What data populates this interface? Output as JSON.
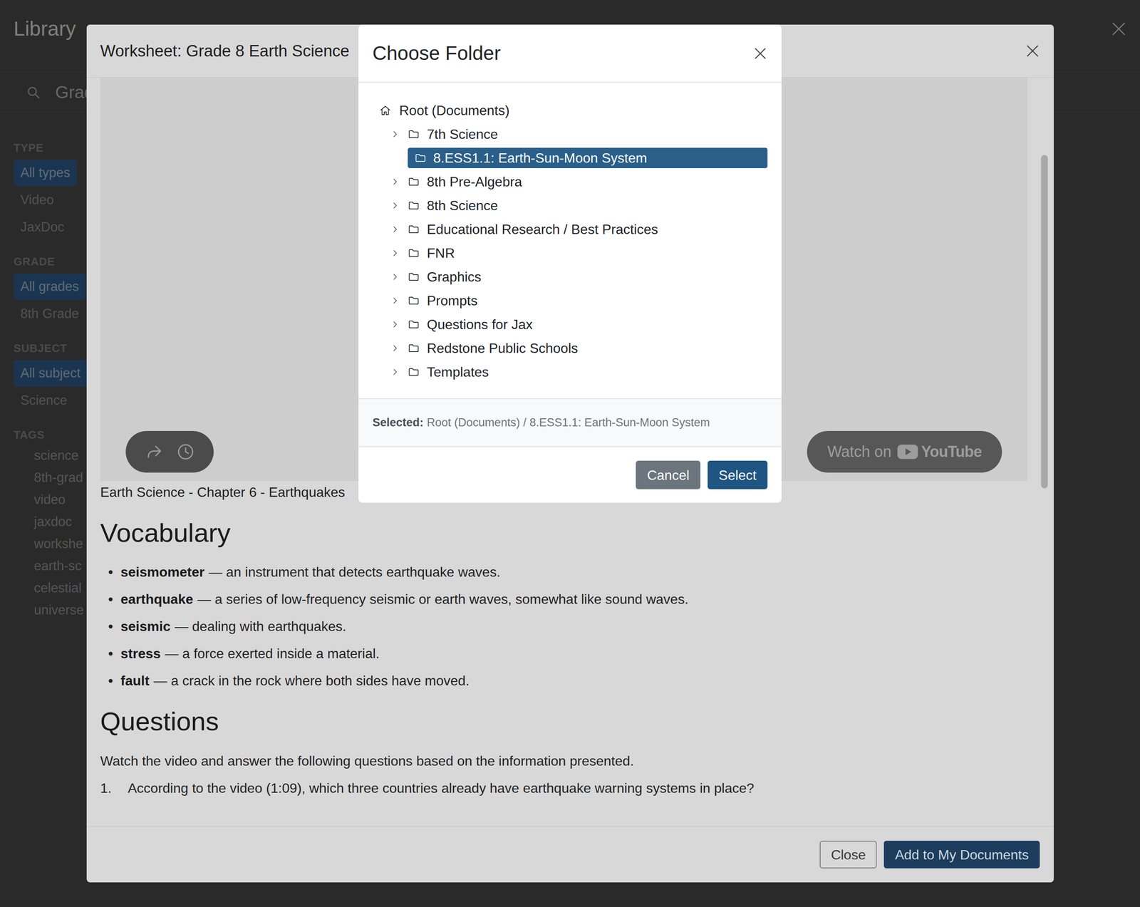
{
  "library": {
    "title": "Library",
    "search": {
      "value": "Grad"
    },
    "filters": [
      {
        "heading": "TYPE",
        "options": [
          {
            "label": "All types",
            "selected": true
          },
          {
            "label": "Video",
            "selected": false
          },
          {
            "label": "JaxDoc",
            "selected": false
          }
        ]
      },
      {
        "heading": "GRADE",
        "options": [
          {
            "label": "All grades",
            "selected": true
          },
          {
            "label": "8th Grade",
            "selected": false
          }
        ]
      },
      {
        "heading": "SUBJECT",
        "options": [
          {
            "label": "All subject",
            "selected": true
          },
          {
            "label": "Science",
            "selected": false
          }
        ]
      }
    ],
    "tags": {
      "heading": "TAGS",
      "items": [
        "science",
        "8th-grad",
        "video",
        "jaxdoc",
        "workshe",
        "earth-sc",
        "celestial",
        "universe"
      ]
    }
  },
  "worksheet": {
    "title": "Worksheet: Grade 8 Earth Science",
    "video": {
      "watch_label": "Watch on",
      "brand": "YouTube"
    },
    "caption": "Earth Science - Chapter 6 - Earthquakes",
    "vocabulary": {
      "heading": "Vocabulary",
      "items": [
        {
          "term": "seismometer",
          "definition": "— an instrument that detects earthquake waves."
        },
        {
          "term": "earthquake",
          "definition": "— a series of low-frequency seismic or earth waves, somewhat like sound waves."
        },
        {
          "term": "seismic",
          "definition": "— dealing with earthquakes."
        },
        {
          "term": "stress",
          "definition": "— a force exerted inside a material."
        },
        {
          "term": "fault",
          "definition": "— a crack in the rock where both sides have moved."
        }
      ]
    },
    "questions": {
      "heading": "Questions",
      "intro": "Watch the video and answer the following questions based on the information presented.",
      "items": [
        {
          "number": "1.",
          "text": "According to the video (1:09), which three countries already have earthquake warning systems in place?"
        }
      ]
    },
    "buttons": [
      {
        "label": "Close",
        "kind": "secondary"
      },
      {
        "label": "Add to My Documents",
        "kind": "primary"
      }
    ]
  },
  "dialog": {
    "title": "Choose Folder",
    "root": "Root (Documents)",
    "folders": [
      {
        "label": "7th Science",
        "expandable": true,
        "expanded": false,
        "selected": false
      },
      {
        "label": "8.ESS1.1: Earth-Sun-Moon System",
        "expandable": false,
        "expanded": false,
        "selected": true
      },
      {
        "label": "8th Pre-Algebra",
        "expandable": true,
        "expanded": false,
        "selected": false
      },
      {
        "label": "8th Science",
        "expandable": true,
        "expanded": false,
        "selected": false
      },
      {
        "label": "Educational Research / Best Practices",
        "expandable": true,
        "expanded": false,
        "selected": false
      },
      {
        "label": "FNR",
        "expandable": true,
        "expanded": false,
        "selected": false
      },
      {
        "label": "Graphics",
        "expandable": true,
        "expanded": false,
        "selected": false
      },
      {
        "label": "Prompts",
        "expandable": true,
        "expanded": false,
        "selected": false
      },
      {
        "label": "Questions for Jax",
        "expandable": true,
        "expanded": false,
        "selected": false
      },
      {
        "label": "Redstone Public Schools",
        "expandable": true,
        "expanded": false,
        "selected": false
      },
      {
        "label": "Templates",
        "expandable": true,
        "expanded": false,
        "selected": false
      }
    ],
    "selected_label": "Selected:",
    "selected_path": "Root (Documents) / 8.ESS1.1: Earth-Sun-Moon System",
    "buttons": [
      {
        "label": "Cancel",
        "kind": "secondary"
      },
      {
        "label": "Select",
        "kind": "primary"
      }
    ]
  }
}
